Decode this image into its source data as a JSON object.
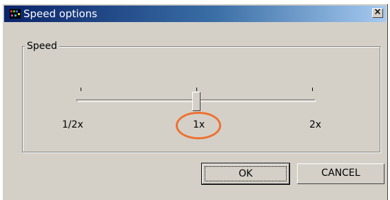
{
  "dialog": {
    "title": "Speed options",
    "close_label": "×"
  },
  "speed_group": {
    "label": "Speed",
    "slider": {
      "value_label": "1x",
      "position": 0.5,
      "ticks": [
        "1/2x",
        "1x",
        "2x"
      ]
    }
  },
  "annotation": {
    "highlight_color": "#ee7030"
  },
  "buttons": {
    "ok": "OK",
    "cancel": "CANCEL"
  },
  "colors": {
    "title_bar_start": "#0a246a",
    "title_bar_end": "#a6caf0",
    "dialog_face": "#d4d0c8"
  },
  "icons": {
    "app": "app-logo-icon",
    "close": "close-icon"
  }
}
